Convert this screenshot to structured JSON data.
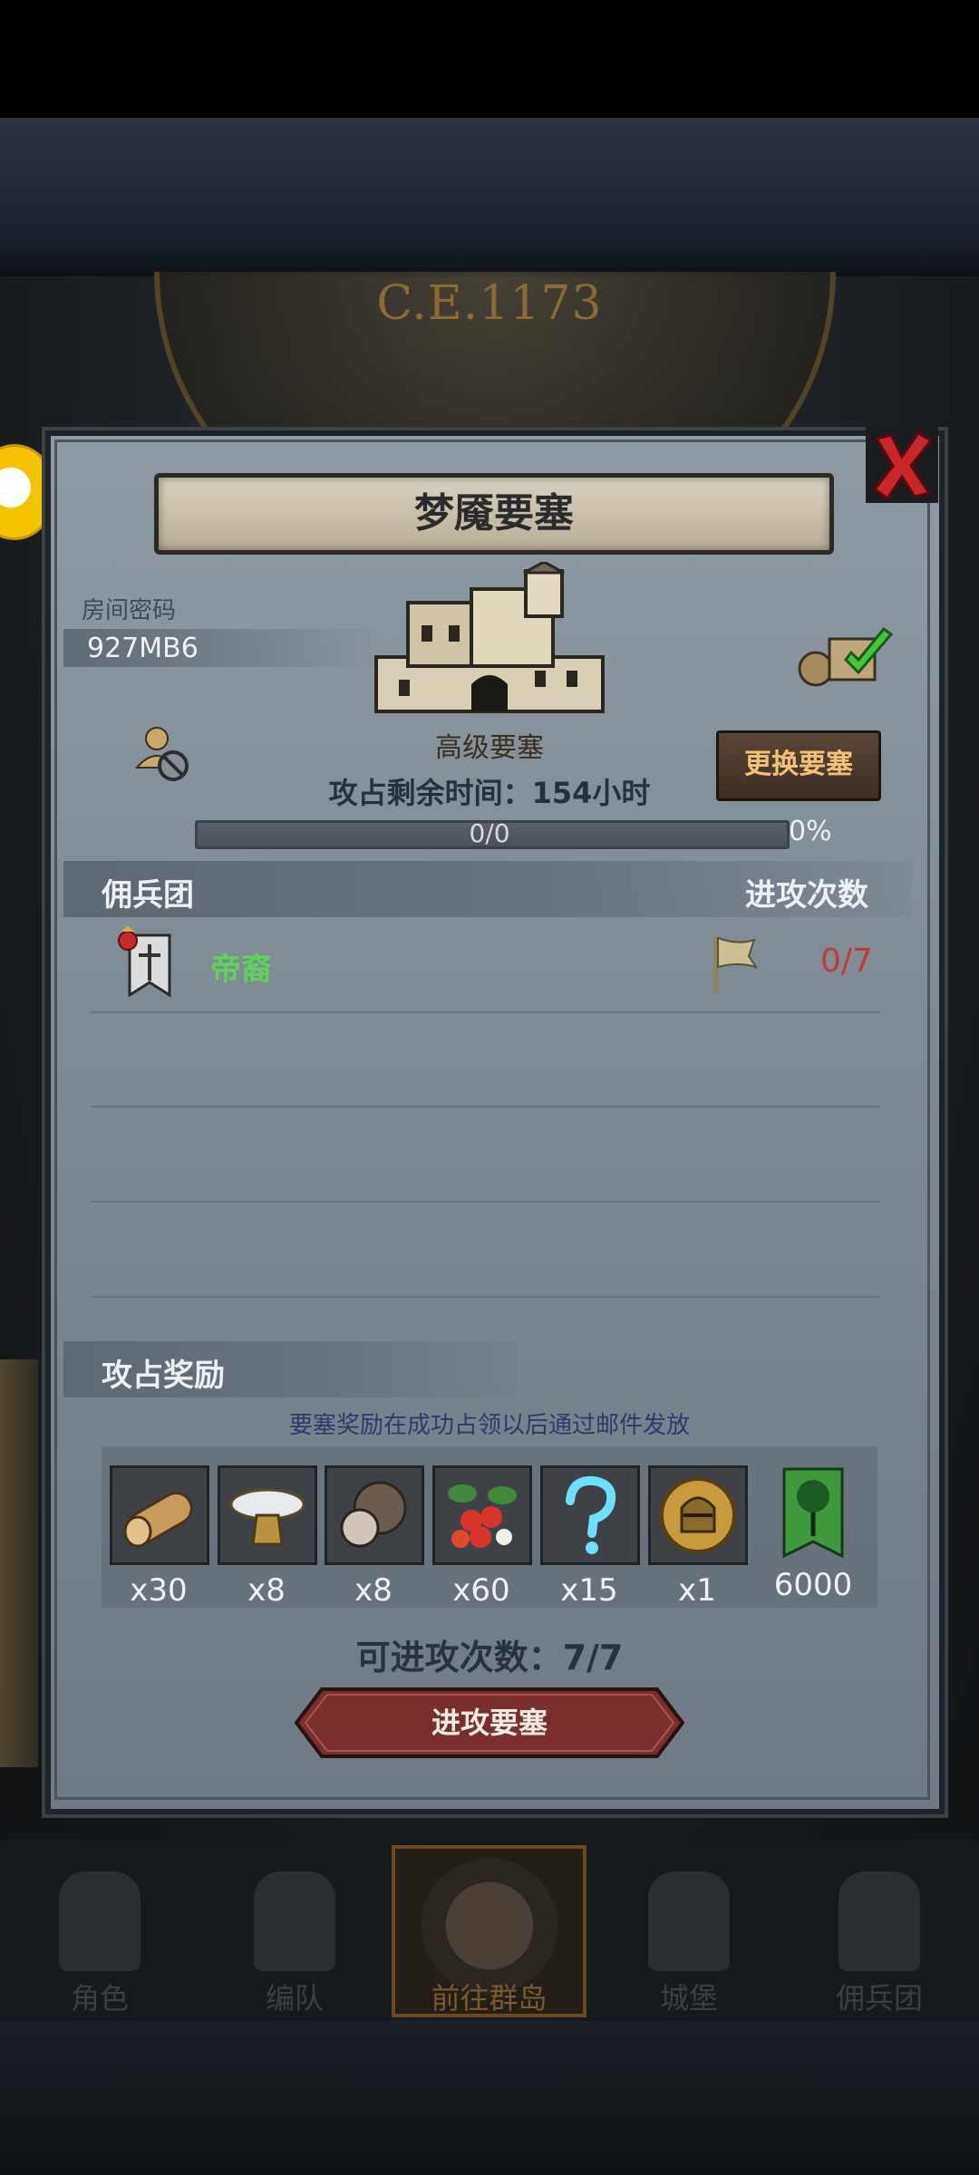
{
  "background": {
    "year_label": "C.E.1173"
  },
  "panel": {
    "title": "梦魇要塞",
    "room_password_label": "房间密码",
    "room_password_value": "927MB6",
    "fortress_rank": "高级要塞",
    "change_button": "更换要塞",
    "timer_text": "攻占剩余时间：154小时",
    "progress": {
      "text": "0/0",
      "percent_label": "0%",
      "value": 0
    },
    "mercenary_header": "佣兵团",
    "attacks_header": "进攻次数",
    "guilds": [
      {
        "name": "帝裔",
        "attacks": "0/7"
      }
    ],
    "reward_header": "攻占奖励",
    "reward_note": "要塞奖励在成功占领以后通过邮件发放",
    "rewards": [
      {
        "icon": "wood-log-icon",
        "qty": "x30"
      },
      {
        "icon": "silver-dish-icon",
        "qty": "x8"
      },
      {
        "icon": "truffle-icon",
        "qty": "x8"
      },
      {
        "icon": "berries-icon",
        "qty": "x60"
      },
      {
        "icon": "mystery-question-icon",
        "qty": "x15"
      },
      {
        "icon": "knight-helmet-coin-icon",
        "qty": "x1"
      },
      {
        "icon": "green-banner-tree-icon",
        "qty": "6000"
      }
    ],
    "attacks_available": "可进攻次数：7/7",
    "attack_button": "进攻要塞"
  },
  "nav": {
    "items": [
      {
        "label": "角色"
      },
      {
        "label": "编队"
      },
      {
        "label": "前往群岛"
      },
      {
        "label": "城堡"
      },
      {
        "label": "佣兵团"
      }
    ]
  },
  "colors": {
    "accent_orange": "#f3c07a",
    "guild_green": "#5fd35a",
    "count_red": "#c23b3b",
    "attack_button": "#7a2f2c"
  }
}
